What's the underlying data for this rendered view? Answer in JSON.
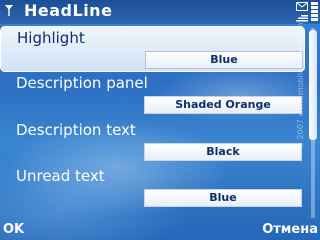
{
  "header": {
    "title": "HeadLine"
  },
  "settings": [
    {
      "label": "Highlight",
      "value": "Blue",
      "selected": true
    },
    {
      "label": "Description panel",
      "value": "Shaded Orange",
      "selected": false
    },
    {
      "label": "Description text",
      "value": "Black",
      "selected": false
    },
    {
      "label": "Unread text",
      "value": "Blue",
      "selected": false
    }
  ],
  "softkeys": {
    "left": "OK",
    "right": "Отмена"
  },
  "watermark": "© 2007 www.mobile-review.com",
  "icons": {
    "signal": "signal-strength-icon",
    "mail": "mail-icon",
    "battery": "battery-icon"
  }
}
